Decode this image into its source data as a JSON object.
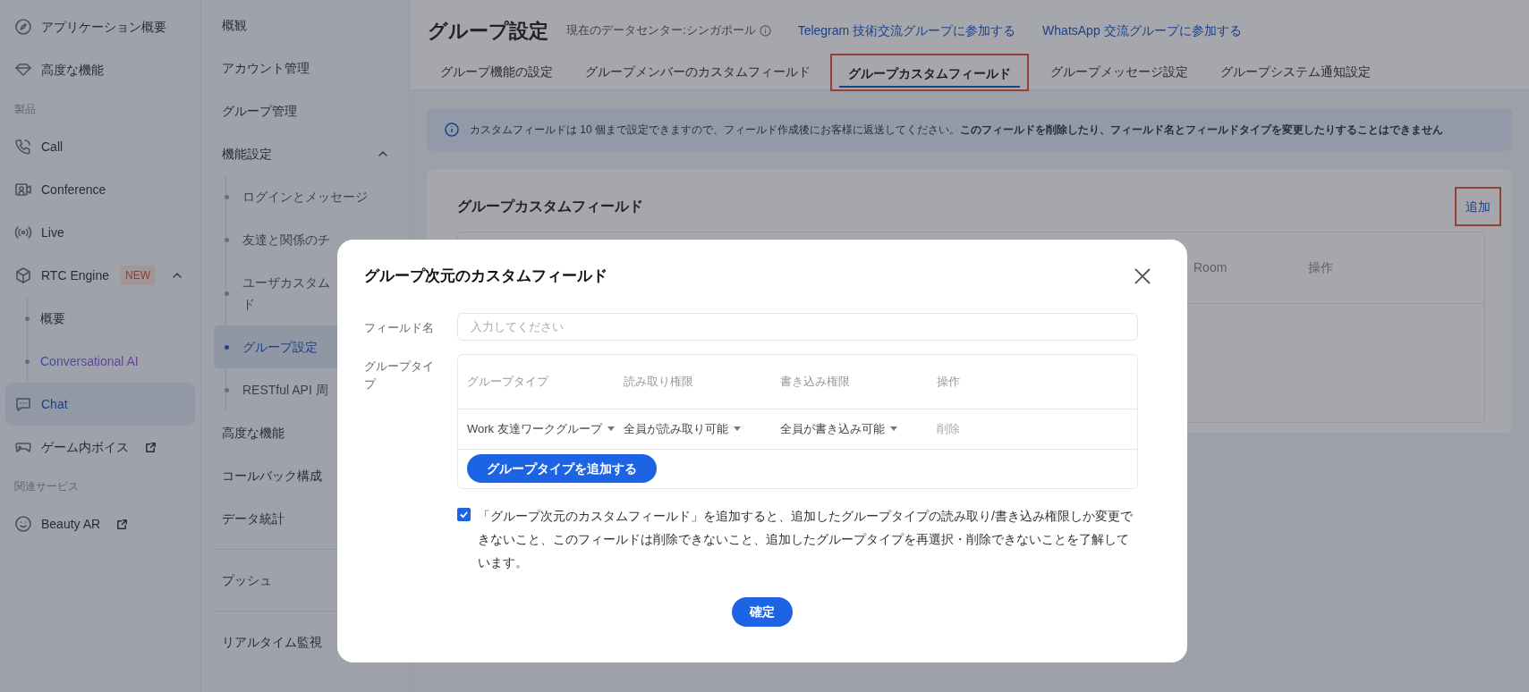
{
  "sidebar": {
    "items": [
      {
        "kind": "item",
        "label": "アプリケーション概要",
        "selected": false
      },
      {
        "kind": "item",
        "label": "高度な機能",
        "selected": false
      },
      {
        "kind": "header",
        "label": "製品"
      },
      {
        "kind": "item",
        "label": "Call",
        "selected": false
      },
      {
        "kind": "item",
        "label": "Conference",
        "selected": false
      },
      {
        "kind": "item",
        "label": "Live",
        "selected": false
      },
      {
        "kind": "item",
        "label": "RTC Engine",
        "badge": "NEW",
        "selected": false,
        "expanded": true,
        "children": [
          {
            "label": "概要",
            "accent": false
          },
          {
            "label": "Conversational AI",
            "accent": true
          }
        ]
      },
      {
        "kind": "item",
        "label": "Chat",
        "selected": true
      },
      {
        "kind": "item",
        "label": "ゲーム内ボイス",
        "selected": false,
        "external": true
      },
      {
        "kind": "header",
        "label": "関連サービス"
      },
      {
        "kind": "item",
        "label": "Beauty AR",
        "selected": false,
        "external": true
      }
    ]
  },
  "sub_nav": {
    "groups": [
      [
        {
          "label": "概観",
          "selected": false
        },
        {
          "label": "アカウント管理",
          "selected": false
        },
        {
          "label": "グループ管理",
          "selected": false
        },
        {
          "label": "機能設定",
          "selected": false,
          "expanded": true,
          "children": [
            {
              "label": "ログインとメッセージ",
              "selected": false
            },
            {
              "label": "友達と関係のチ",
              "selected": false
            },
            {
              "label": "ユーザカスタムド",
              "selected": false
            },
            {
              "label": "グループ設定",
              "selected": true
            },
            {
              "label": "RESTful API 周",
              "selected": false
            }
          ]
        },
        {
          "label": "高度な機能",
          "selected": false
        },
        {
          "label": "コールバック構成",
          "selected": false
        },
        {
          "label": "データ統計",
          "selected": false
        }
      ],
      [
        {
          "label": "プッシュ",
          "selected": false
        }
      ],
      [
        {
          "label": "リアルタイム監視",
          "selected": false
        }
      ]
    ]
  },
  "header": {
    "title": "グループ設定",
    "datacenter": "現在のデータセンター:シンガポール",
    "links": [
      "Telegram 技術交流グループに参加する",
      "WhatsApp 交流グループに参加する"
    ]
  },
  "tabs": [
    {
      "label": "グループ機能の設定",
      "selected": false,
      "annotated": false
    },
    {
      "label": "グループメンバーのカスタムフィールド",
      "selected": false,
      "annotated": false
    },
    {
      "label": "グループカスタムフィールド",
      "selected": true,
      "annotated": true
    },
    {
      "label": "グループメッセージ設定",
      "selected": false,
      "annotated": false
    },
    {
      "label": "グループシステム通知設定",
      "selected": false,
      "annotated": false
    }
  ],
  "notice": "カスタムフィールドは 10 個まで設定できますので、フィールド作成後にお客様に返送してください。**このフィールドを削除したり、フィールド名とフィールドタイプを変更したりすることはできません**",
  "card": {
    "title": "グループカスタムフィールド",
    "add_link": {
      "label": "追加",
      "annotated": true
    },
    "table": {
      "columns": [
        "Room",
        "操作"
      ]
    }
  },
  "modal": {
    "title": "グループ次元のカスタムフィールド",
    "field_name": {
      "label": "フィールド名",
      "placeholder": "入力してください"
    },
    "group_type": {
      "label": "グループタイプ",
      "columns": [
        "グループタイプ",
        "読み取り権限",
        "書き込み権限",
        "操作"
      ],
      "rows": [
        {
          "group_type": "Work 友達ワークグループ",
          "read": "全員が読み取り可能",
          "write": "全員が書き込み可能",
          "action": "削除"
        }
      ],
      "add_button": "グループタイプを追加する"
    },
    "agreement": {
      "checked": true,
      "text": "「グループ次元のカスタムフィールド」を追加すると、追加したグループタイプの読み取り/書き込み権限しか変更できないこと、このフィールドは削除できないこと、追加したグループタイプを再選択・削除できないことを了解しています。"
    },
    "confirm": "確定"
  }
}
